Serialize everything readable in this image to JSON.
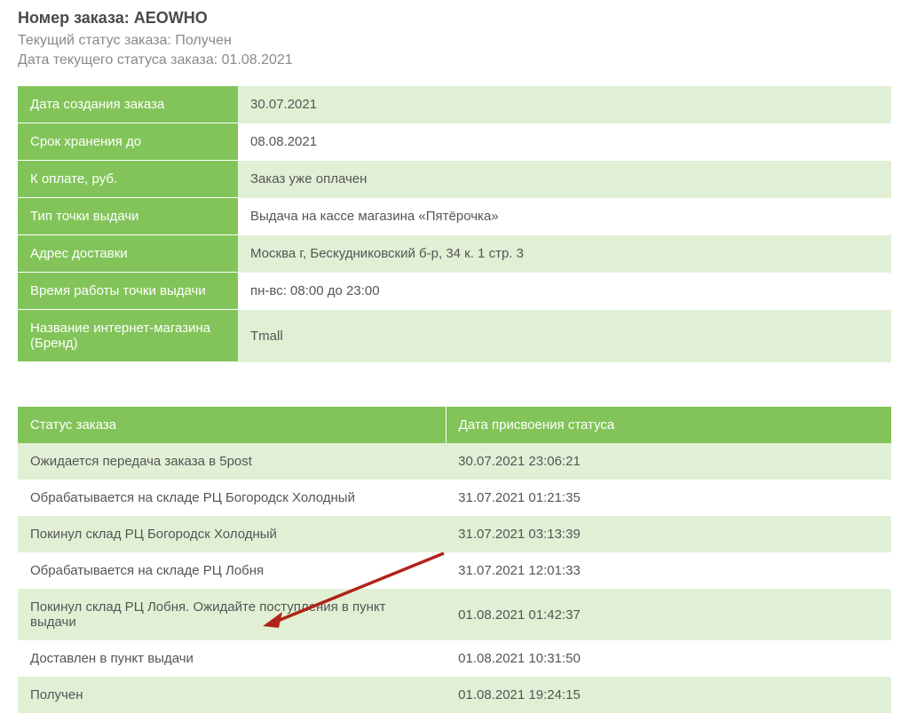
{
  "header": {
    "order_number_label": "Номер заказа: ",
    "order_number_value": "AEOWHO",
    "current_status_label": "Текущий статус заказа: ",
    "current_status_value": "Получен",
    "status_date_label": "Дата текущего статуса заказа: ",
    "status_date_value": "01.08.2021"
  },
  "info": [
    {
      "label": "Дата создания заказа",
      "value": "30.07.2021"
    },
    {
      "label": "Срок хранения до",
      "value": "08.08.2021"
    },
    {
      "label": "К оплате, руб.",
      "value": "Заказ уже оплачен"
    },
    {
      "label": "Тип точки выдачи",
      "value": "Выдача на кассе магазина «Пятёрочка»"
    },
    {
      "label": "Адрес доставки",
      "value": "Москва г, Бескудниковский б-р, 34 к. 1 стр. 3"
    },
    {
      "label": "Время работы точки выдачи",
      "value": "пн-вс: 08:00 до 23:00"
    },
    {
      "label": "Название интернет-магазина (Бренд)",
      "value": "Tmall"
    }
  ],
  "status_history": {
    "header_status": "Статус заказа",
    "header_date": "Дата присвоения статуса",
    "rows": [
      {
        "status": "Ожидается передача заказа в 5post",
        "date": "30.07.2021 23:06:21"
      },
      {
        "status": "Обрабатывается на складе РЦ Богородск Холодный",
        "date": "31.07.2021 01:21:35"
      },
      {
        "status": "Покинул склад РЦ Богородск Холодный",
        "date": "31.07.2021 03:13:39"
      },
      {
        "status": "Обрабатывается на складе РЦ Лобня",
        "date": "31.07.2021 12:01:33"
      },
      {
        "status": "Покинул склад РЦ Лобня. Ожидайте поступления в пункт выдачи",
        "date": "01.08.2021 01:42:37"
      },
      {
        "status": "Доставлен в пункт выдачи",
        "date": "01.08.2021 10:31:50"
      },
      {
        "status": "Получен",
        "date": "01.08.2021 19:24:15"
      }
    ]
  }
}
